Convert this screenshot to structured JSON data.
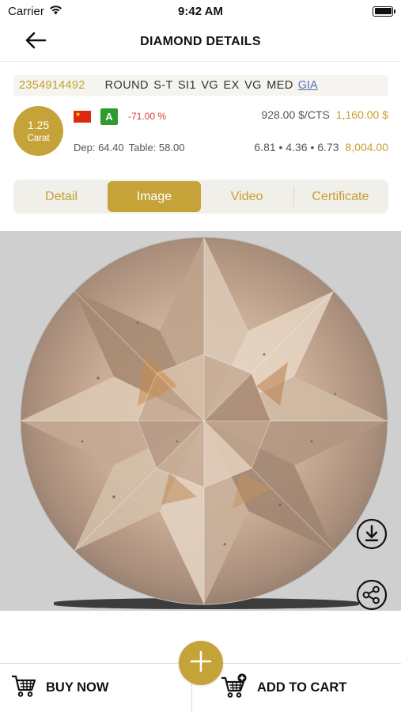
{
  "status_bar": {
    "carrier": "Carrier",
    "time": "9:42 AM"
  },
  "nav": {
    "title": "DIAMOND DETAILS"
  },
  "stone": {
    "id": "2354914492",
    "description": "ROUND S-T SI1 VG EX VG MED",
    "lab": "GIA",
    "carat_value": "1.25",
    "carat_label": "Carat",
    "grade": "A",
    "discount": "-71.00 %",
    "price_per_carat": "928.00 $/CTS",
    "price_total": "1,160.00 $",
    "depth": "Dep: 64.40",
    "table": "Table: 58.00",
    "measurements": "6.81 • 4.36 • 6.73",
    "amount": "8,004.00"
  },
  "tabs": [
    {
      "label": "Detail",
      "active": false
    },
    {
      "label": "Image",
      "active": true
    },
    {
      "label": "Video",
      "active": false
    },
    {
      "label": "Certificate",
      "active": false
    }
  ],
  "actions": {
    "buy_now": "BUY NOW",
    "add_to_cart": "ADD TO CART"
  },
  "colors": {
    "accent": "#c6a338",
    "accent_text": "#c4a02f",
    "discount": "#d93a3a",
    "grade_badge": "#2e9b2e"
  }
}
